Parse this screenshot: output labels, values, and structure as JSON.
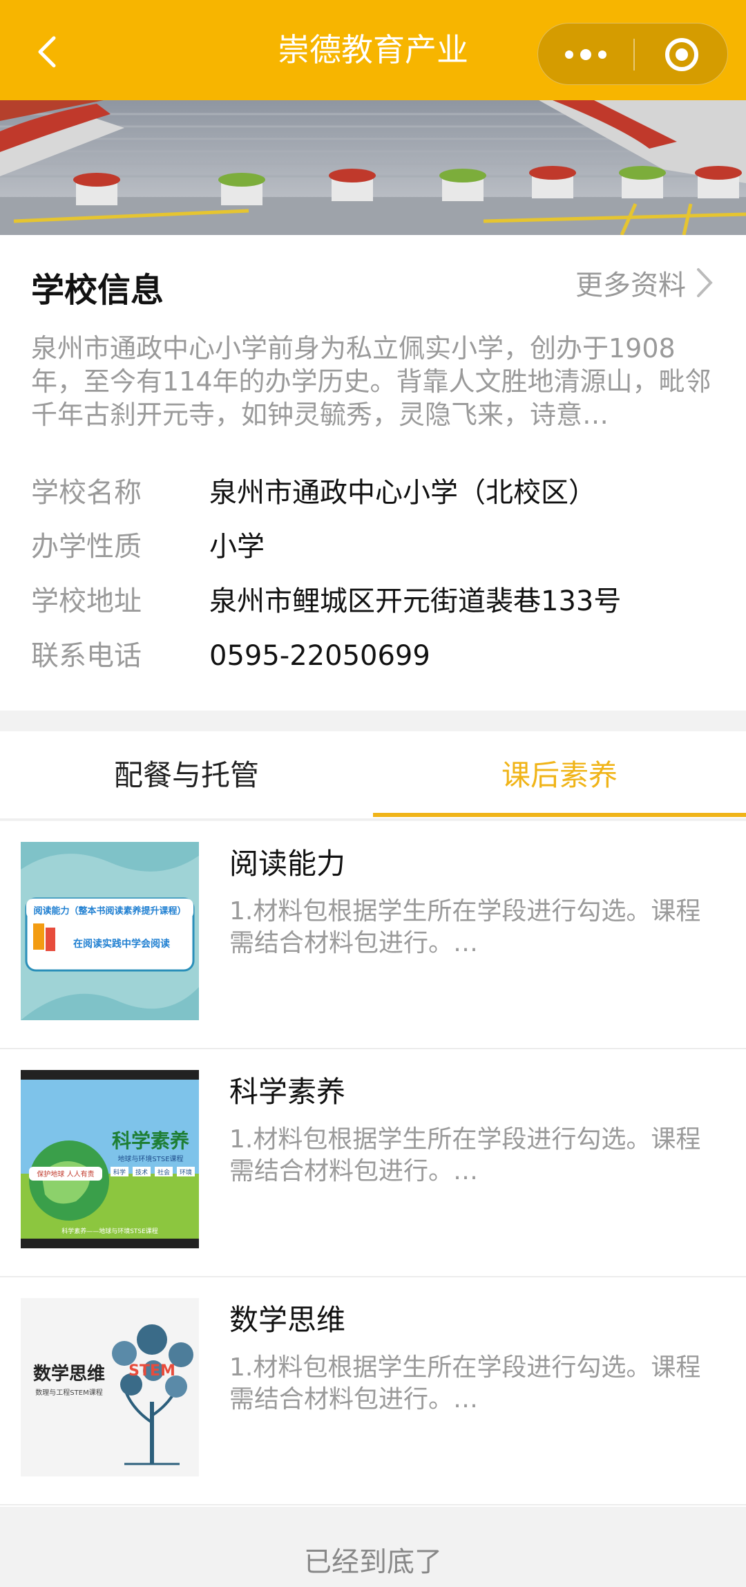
{
  "header": {
    "title": "崇德教育产业",
    "back_icon": "back-chevron-icon",
    "more_icon": "more-dots-icon",
    "close_icon": "target-circle-icon",
    "bg_color": "#f7b500"
  },
  "school_info": {
    "section_title": "学校信息",
    "more_label": "更多资料",
    "description": "泉州市通政中心小学前身为私立佩实小学，创办于1908年，至今有114年的办学历史。背靠人文胜地清源山，毗邻千年古刹开元寺，如钟灵毓秀，灵隐飞来，诗意…",
    "rows": [
      {
        "key": "学校名称",
        "value": "泉州市通政中心小学（北校区）"
      },
      {
        "key": "办学性质",
        "value": "小学"
      },
      {
        "key": "学校地址",
        "value": "泉州市鲤城区开元街道裴巷133号"
      },
      {
        "key": "联系电话",
        "value": "0595-22050699"
      }
    ]
  },
  "tabs": [
    {
      "label": "配餐与托管",
      "active": false
    },
    {
      "label": "课后素养",
      "active": true
    }
  ],
  "accent_color": "#f0b418",
  "courses": [
    {
      "title": "阅读能力",
      "desc": "1.材料包根据学生所在学段进行勾选。课程需结合材料包进行。…",
      "thumb": {
        "line1": "阅读能力（整本书阅读素养提升课程）",
        "line2": "在阅读实践中学会阅读"
      }
    },
    {
      "title": "科学素养",
      "desc": "1.材料包根据学生所在学段进行勾选。课程需结合材料包进行。…",
      "thumb": {
        "line1": "科学素养",
        "line2": "地球与环境STSE课程",
        "tags": [
          "科学",
          "技术",
          "社会",
          "环境"
        ],
        "badge": "保护地球 人人有责",
        "footer": "科学素养——地球与环境STSE课程"
      }
    },
    {
      "title": "数学思维",
      "desc": "1.材料包根据学生所在学段进行勾选。课程需结合材料包进行。…",
      "thumb": {
        "line1": "数学思维",
        "line2": "数理与工程STEM课程",
        "tree": "STEM"
      }
    }
  ],
  "footer": {
    "end_text": "已经到底了"
  }
}
